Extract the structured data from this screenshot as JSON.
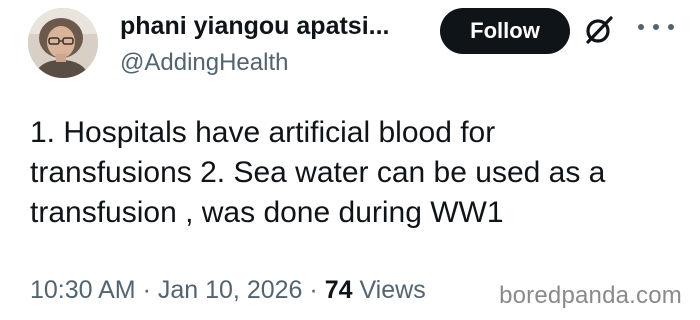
{
  "header": {
    "display_name": "phani yiangou apatsi...",
    "handle": "@AddingHealth",
    "follow_label": "Follow",
    "grok_icon": "slashed-circle-icon",
    "more_icon": "more-dots-icon"
  },
  "tweet": {
    "lines": [
      "1. Hospitals have artificial blood for",
      "transfusions 2. Sea water can be used as a",
      "transfusion , was done during WW1"
    ]
  },
  "footer": {
    "time": "10:30 AM",
    "sep1": "·",
    "date": "Jan 10, 2026",
    "sep2": "·",
    "views_count": "74",
    "views_label": "Views"
  },
  "watermark": {
    "text": "boredpanda.com"
  },
  "colors": {
    "text_primary": "#0f1419",
    "text_secondary": "#536471",
    "button_bg": "#0f1419",
    "button_text": "#ffffff"
  }
}
